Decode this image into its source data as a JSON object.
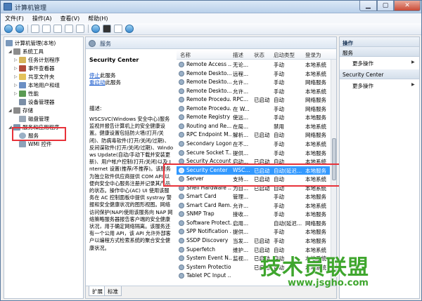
{
  "window": {
    "title": "计算机管理"
  },
  "menu": [
    "文件(F)",
    "操作(A)",
    "查看(V)",
    "帮助(H)"
  ],
  "tree": {
    "root": "计算机管理(本地)",
    "system_tools": "系统工具",
    "task_scheduler": "任务计划程序",
    "event_viewer": "事件查看器",
    "shared_folders": "共享文件夹",
    "local_users": "本地用户和组",
    "performance": "性能",
    "device_manager": "设备管理器",
    "storage": "存储",
    "disk_management": "磁盘管理",
    "services_apps": "服务和应用程序",
    "services": "服务",
    "wmi": "WMI 控件"
  },
  "header": {
    "title": "服务"
  },
  "desc": {
    "service_name": "Security Center",
    "stop_link": "停止",
    "stop_suffix": "此服务",
    "restart_link": "重启动",
    "restart_suffix": "此服务",
    "label": "描述:",
    "text": "WSCSVC(Windows 安全中心)服务监视并报告计算机上的安全健康设置。健康设置包括防火墙(打开/关闭)、防病毒软件(打开/关闭/过期)、反间谍软件(打开/关闭/过期)、Windows Update(自动/手动下载并安装更新)、用户帐户控制(打开/关闭)以及 Internet 设置(推荐/不推荐)。该服务为独立软件供应商提供 COM API 以便向安全中心服务注册并记录其产品的状态。操作中心(AC) UI 使用该服务在 AC 控制面板中提供 systray 警报和安全健康状况的图形视图。网络访问保护(NAP)使用该服务向 NAP 网络策略服务器报告客户端的安全健康状况，用于确定网络隔离。该服务还有一个公用 API，该 API 允许外部客户以编程方式检索系统的聚合安全健康状况。"
  },
  "columns": {
    "name": "名称",
    "desc": "描述",
    "status": "状态",
    "startup": "启动类型",
    "logon": "登录为"
  },
  "rows": [
    {
      "name": "Remote Access ...",
      "desc": "无论...",
      "status": "",
      "startup": "手动",
      "logon": "本地系统"
    },
    {
      "name": "Remote Deskto...",
      "desc": "远程...",
      "status": "",
      "startup": "手动",
      "logon": "本地系统"
    },
    {
      "name": "Remote Deskto...",
      "desc": "允许...",
      "status": "",
      "startup": "手动",
      "logon": "网络服务"
    },
    {
      "name": "Remote Deskto...",
      "desc": "允许...",
      "status": "",
      "startup": "手动",
      "logon": "本地系统"
    },
    {
      "name": "Remote Procedu...",
      "desc": "RPC...",
      "status": "已启动",
      "startup": "自动",
      "logon": "网络服务"
    },
    {
      "name": "Remote Procedu...",
      "desc": "在 W...",
      "status": "",
      "startup": "手动",
      "logon": "网络服务"
    },
    {
      "name": "Remote Registry",
      "desc": "使远...",
      "status": "",
      "startup": "手动",
      "logon": "本地服务"
    },
    {
      "name": "Routing and Re...",
      "desc": "在局...",
      "status": "",
      "startup": "禁用",
      "logon": "本地系统"
    },
    {
      "name": "RPC Endpoint M...",
      "desc": "解析...",
      "status": "已启动",
      "startup": "自动",
      "logon": "网络服务"
    },
    {
      "name": "Secondary Logon",
      "desc": "在不...",
      "status": "",
      "startup": "手动",
      "logon": "本地系统"
    },
    {
      "name": "Secure Socket T...",
      "desc": "提供...",
      "status": "",
      "startup": "手动",
      "logon": "本地服务"
    },
    {
      "name": "Security Account...",
      "desc": "启动...",
      "status": "已启动",
      "startup": "自动",
      "logon": "本地系统"
    },
    {
      "name": "Security Center",
      "desc": "WSC...",
      "status": "已启动",
      "startup": "自动(延迟...",
      "logon": "本地服务"
    },
    {
      "name": "Server",
      "desc": "支持...",
      "status": "已启动",
      "startup": "自动",
      "logon": "本地系统"
    },
    {
      "name": "Shell Hardware ...",
      "desc": "为自...",
      "status": "已启动",
      "startup": "自动",
      "logon": "本地系统"
    },
    {
      "name": "Smart Card",
      "desc": "管理...",
      "status": "",
      "startup": "手动",
      "logon": "本地服务"
    },
    {
      "name": "Smart Card Rem...",
      "desc": "允许...",
      "status": "",
      "startup": "手动",
      "logon": "本地系统"
    },
    {
      "name": "SNMP Trap",
      "desc": "接收...",
      "status": "",
      "startup": "手动",
      "logon": "本地服务"
    },
    {
      "name": "Software Protect...",
      "desc": "启用...",
      "status": "",
      "startup": "自动(延迟...",
      "logon": "网络服务"
    },
    {
      "name": "SPP Notification ...",
      "desc": "提供...",
      "status": "",
      "startup": "手动",
      "logon": "本地服务"
    },
    {
      "name": "SSDP Discovery",
      "desc": "当发...",
      "status": "已启动",
      "startup": "手动",
      "logon": "本地服务"
    },
    {
      "name": "Superfetch",
      "desc": "维护...",
      "status": "已启动",
      "startup": "自动",
      "logon": "本地系统"
    },
    {
      "name": "System Event N...",
      "desc": "监视...",
      "status": "已启动",
      "startup": "自动",
      "logon": "本地系统"
    },
    {
      "name": "System Protectio...",
      "desc": "",
      "status": "已启动",
      "startup": "自动",
      "logon": "本地系统"
    },
    {
      "name": "Tablet PC Input ...",
      "desc": "",
      "status": "",
      "startup": "",
      "logon": ""
    }
  ],
  "tabs": [
    "扩展",
    "标准"
  ],
  "actions": {
    "header": "操作",
    "section1": "服务",
    "more1": "更多操作",
    "section2": "Security Center",
    "more2": "更多操作"
  },
  "watermark": {
    "line1": "技术员联盟",
    "line2": "www.jsgho.com"
  }
}
